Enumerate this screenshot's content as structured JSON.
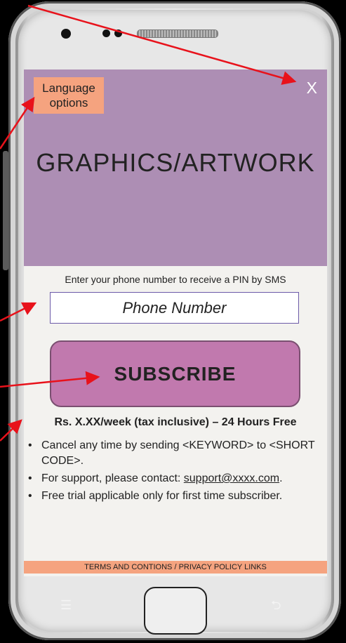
{
  "hero": {
    "language_label": "Language options",
    "close_label": "X",
    "title": "GRAPHICS/ARTWORK"
  },
  "form": {
    "instruction": "Enter your phone number to receive a PIN by SMS",
    "phone_placeholder": "Phone Number",
    "subscribe_label": "SUBSCRIBE"
  },
  "pricing": {
    "price_text": "Rs. X.XX/week (tax inclusive)  – 24 Hours Free"
  },
  "terms": {
    "bullets": [
      "Cancel any time by sending <KEYWORD> to <SHORT CODE>.",
      "For support, please contact: ",
      "Free trial applicable only for first time subscriber."
    ],
    "support_email": "support@xxxx.com",
    "support_suffix": "."
  },
  "footer": {
    "terms_label": "TERMS AND CONTIONS",
    "separator": " / ",
    "privacy_label": "PRIVACY POLICY LINKS"
  },
  "colors": {
    "hero_bg": "#ad8eb4",
    "accent_orange": "#f5a37f",
    "subscribe_bg": "#c179ae",
    "annotation_arrow": "#e8121b"
  }
}
